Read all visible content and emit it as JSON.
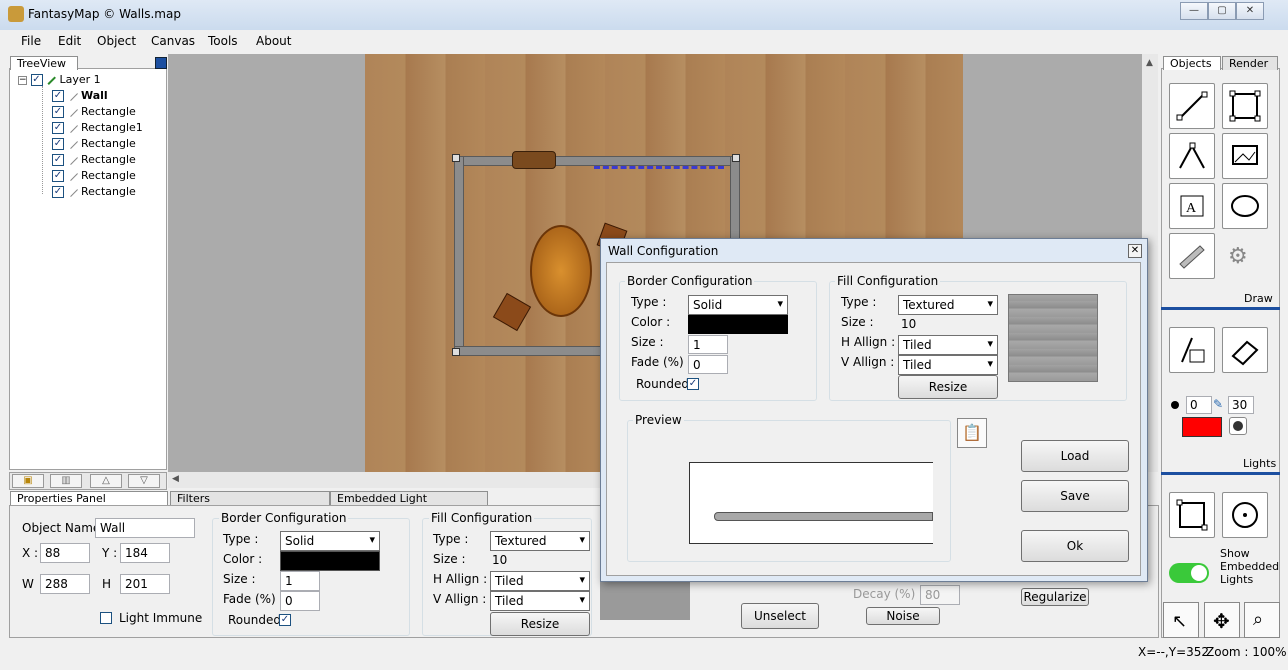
{
  "window": {
    "title": "FantasyMap © Walls.map",
    "controls": [
      "—",
      "▢",
      "✕"
    ]
  },
  "menu": [
    "File",
    "Edit",
    "Object",
    "Canvas",
    "Tools",
    "About"
  ],
  "treeview": {
    "tab": "TreeView",
    "layer": "Layer 1",
    "items": [
      "Wall",
      "Rectangle",
      "Rectangle1",
      "Rectangle",
      "Rectangle",
      "Rectangle",
      "Rectangle"
    ]
  },
  "right_panel": {
    "tabs": [
      "Objects",
      "Render"
    ],
    "draw_label": "Draw",
    "lights_label": "Lights",
    "brush_size": "0",
    "pen_size": "30",
    "show_embedded_lights": "Show Embedded Lights",
    "tool_icons": [
      "line-tool-icon",
      "rectangle-tool-icon",
      "polyline-tool-icon",
      "image-tool-icon",
      "text-tool-icon",
      "ellipse-tool-icon",
      "wall-tool-icon",
      "settings-gear-icon"
    ]
  },
  "bottom_panel": {
    "tabs": [
      "Properties Panel",
      "Filters",
      "Embedded Light"
    ],
    "object_name_label": "Object Name",
    "object_name": "Wall",
    "x_label": "X :",
    "x": "88",
    "y_label": "Y :",
    "y": "184",
    "w_label": "W",
    "w": "288",
    "h_label": "H",
    "h": "201",
    "light_immune": "Light Immune",
    "border": {
      "title": "Border Configuration",
      "type_label": "Type :",
      "type": "Solid",
      "color_label": "Color :",
      "size_label": "Size :",
      "size": "1",
      "fade_label": "Fade (%) :",
      "fade": "0",
      "rounded": "Rounded"
    },
    "fill": {
      "title": "Fill Configuration",
      "type_label": "Type :",
      "type": "Textured",
      "size_label": "Size :",
      "size": "10",
      "halign_label": "H Allign :",
      "halign": "Tiled",
      "valign_label": "V Allign :",
      "valign": "Tiled",
      "resize": "Resize"
    },
    "unselect": "Unselect",
    "decay_label": "Decay (%)",
    "decay": "80",
    "noise": "Noise",
    "regularize": "Regularize"
  },
  "status": {
    "coords": "X=--,Y=352",
    "zoom": "Zoom : 100%"
  },
  "dialog": {
    "title": "Wall Configuration",
    "border": {
      "title": "Border Configuration",
      "type_label": "Type :",
      "type": "Solid",
      "color_label": "Color :",
      "size_label": "Size :",
      "size": "1",
      "fade_label": "Fade (%) :",
      "fade": "0",
      "rounded": "Rounded"
    },
    "fill": {
      "title": "Fill Configuration",
      "type_label": "Type :",
      "type": "Textured",
      "size_label": "Size :",
      "size": "10",
      "halign_label": "H Allign :",
      "halign": "Tiled",
      "valign_label": "V Allign :",
      "valign": "Tiled",
      "resize": "Resize"
    },
    "preview_label": "Preview",
    "load": "Load",
    "save": "Save",
    "ok": "Ok"
  },
  "colors": {
    "border_color": "#000000",
    "brush_color": "#ff0000",
    "toggle": "#3ac93a",
    "accent_blue": "#1c4fa0"
  }
}
